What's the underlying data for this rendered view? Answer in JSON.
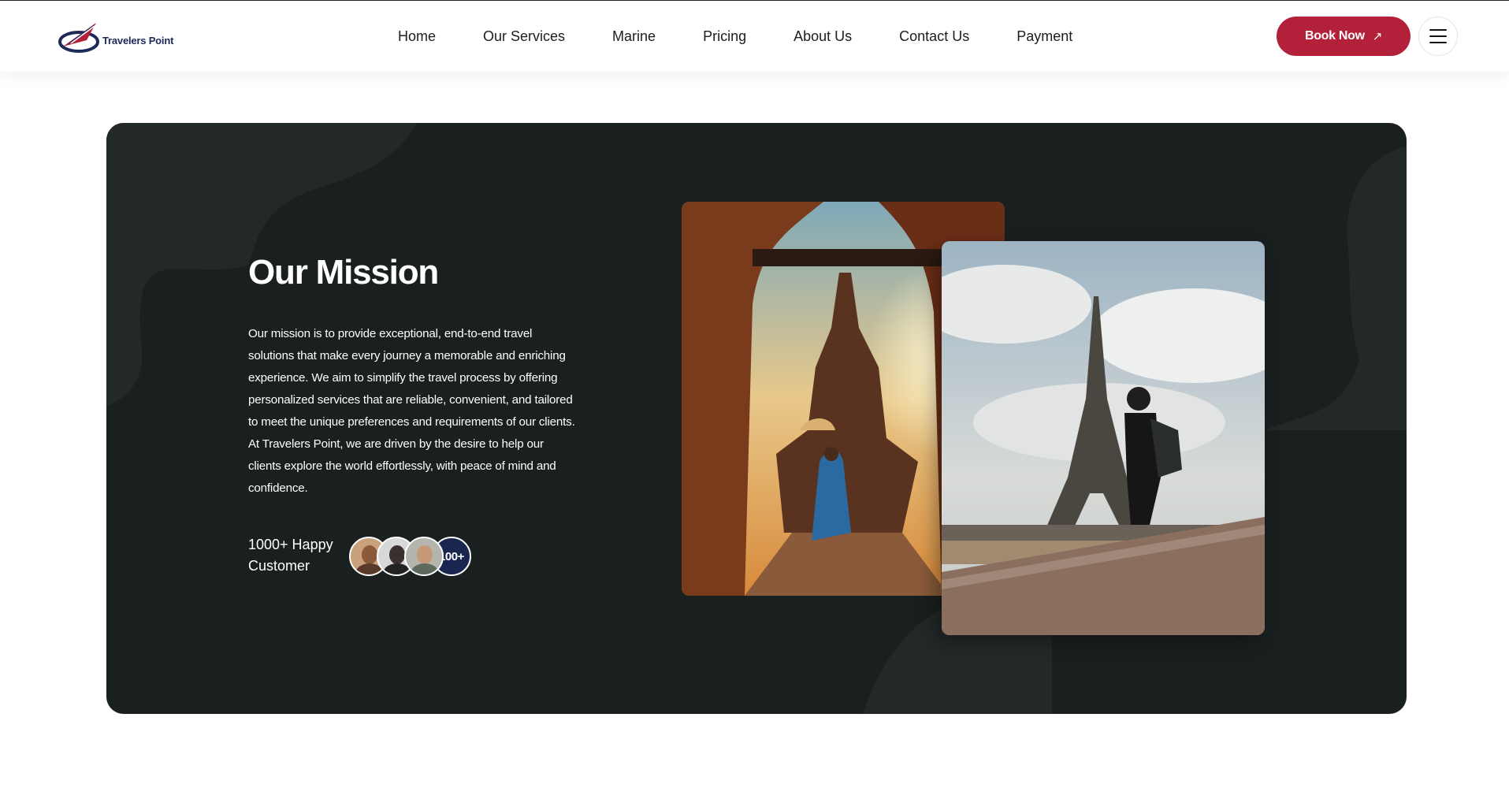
{
  "header": {
    "logo_text": "Travelers Point",
    "nav": [
      "Home",
      "Our Services",
      "Marine",
      "Pricing",
      "About Us",
      "Contact Us",
      "Payment"
    ],
    "book_label": "Book Now",
    "book_icon": "arrow-up-right-icon",
    "menu_icon": "hamburger-icon"
  },
  "mission": {
    "title": "Our Mission",
    "body": "Our mission is to provide exceptional, end-to-end travel solutions that make every journey a memorable and enriching experience. We aim to simplify the travel process by offering personalized services that are reliable, convenient, and tailored to meet the unique preferences and requirements of our clients. At Travelers Point, we are driven by the desire to help our clients explore the world effortlessly, with peace of mind and confidence.",
    "happy_customers": "1000+ Happy Customer",
    "avatar_count": "100+"
  },
  "colors": {
    "accent": "#b3203a",
    "section_bg": "#1a1f1f",
    "navy": "#1a2550"
  }
}
